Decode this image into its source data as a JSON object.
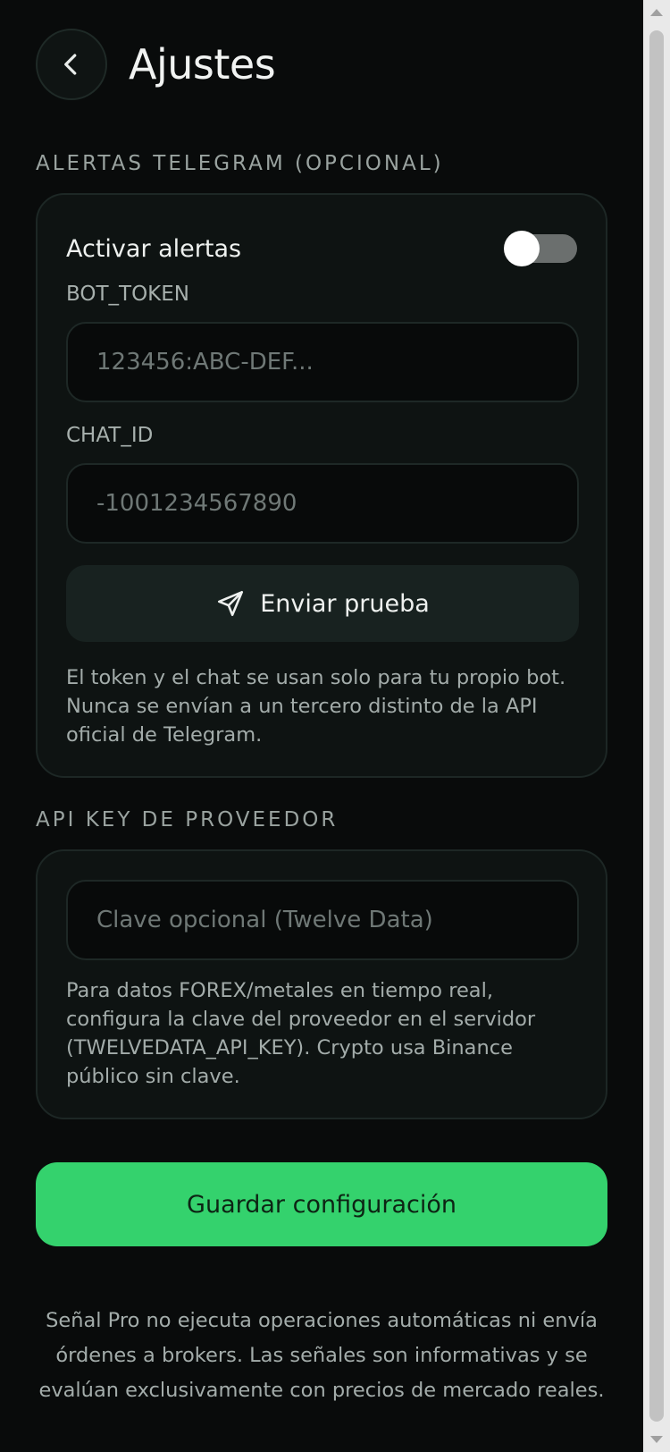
{
  "header": {
    "title": "Ajustes",
    "back_icon": "chevron-left-icon"
  },
  "telegram": {
    "section_label": "ALERTAS TELEGRAM (OPCIONAL)",
    "toggle_label": "Activar alertas",
    "toggle_on": false,
    "bot_token_label": "BOT_TOKEN",
    "bot_token_placeholder": "123456:ABC-DEF...",
    "chat_id_label": "CHAT_ID",
    "chat_id_placeholder": "-1001234567890",
    "send_button_label": "Enviar prueba",
    "send_icon": "send-icon",
    "help_text": "El token y el chat se usan solo para tu propio bot. Nunca se envían a un tercero distinto de la API oficial de Telegram."
  },
  "provider": {
    "section_label": "API KEY DE PROVEEDOR",
    "api_key_placeholder": "Clave opcional (Twelve Data)",
    "help_text": "Para datos FOREX/metales en tiempo real, configura la clave del proveedor en el servidor (TWELVEDATA_API_KEY). Crypto usa Binance público sin clave."
  },
  "save_button_label": "Guardar configuración",
  "footer_text": "Señal Pro no ejecuta operaciones automáticas ni envía órdenes a brokers. Las señales son informativas y se evalúan exclusivamente con precios de mercado reales.",
  "colors": {
    "background": "#090b0b",
    "accent": "#34d26d",
    "card": "#0e1312"
  }
}
